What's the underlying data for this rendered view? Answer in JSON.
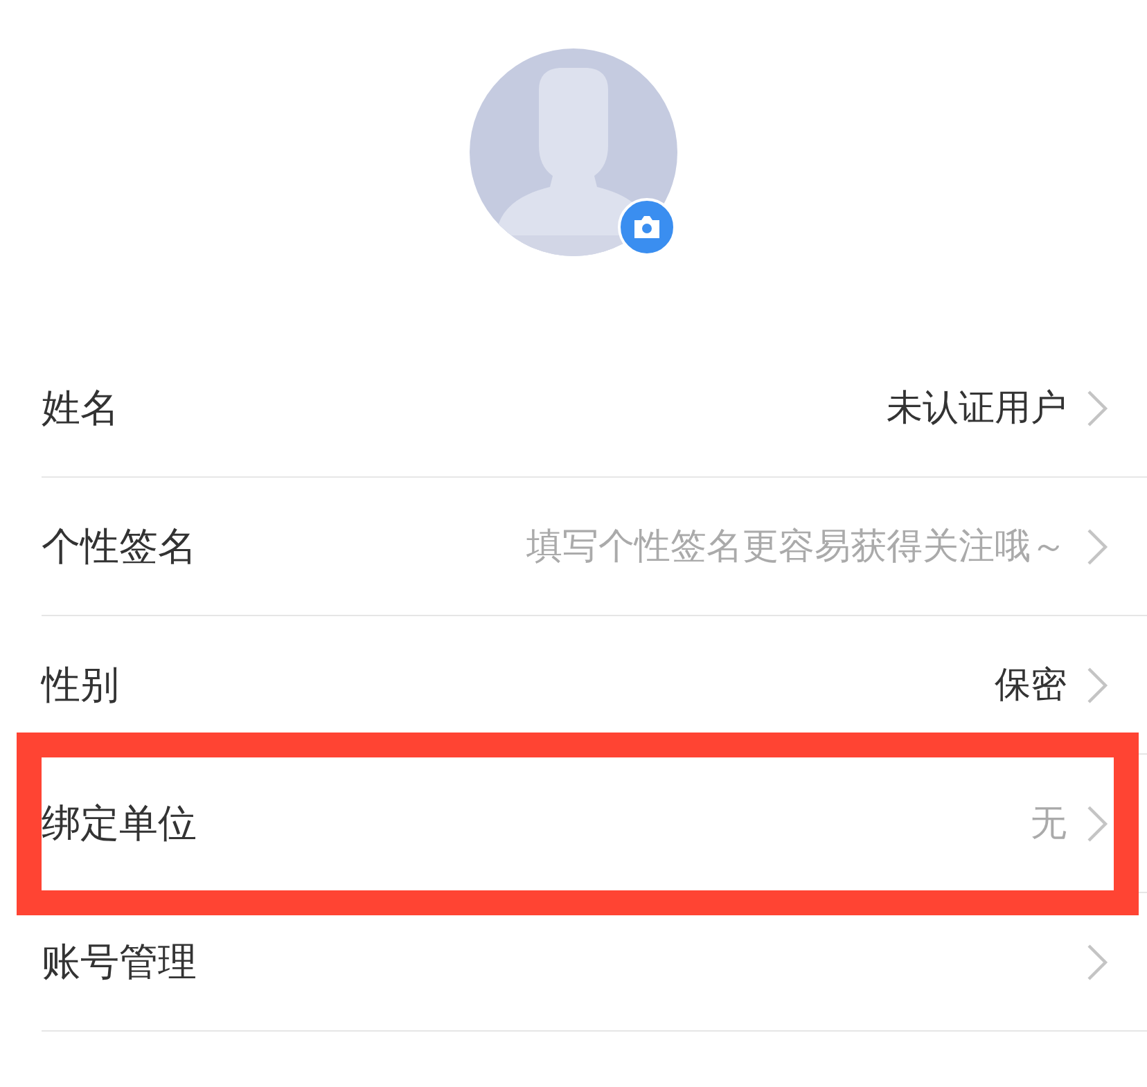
{
  "profile": {
    "avatar": {
      "editable": true
    }
  },
  "rows": [
    {
      "label": "姓名",
      "value": "未认证用户",
      "dimmed": false,
      "highlighted": false
    },
    {
      "label": "个性签名",
      "value": "填写个性签名更容易获得关注哦～",
      "dimmed": true,
      "highlighted": false
    },
    {
      "label": "性别",
      "value": "保密",
      "dimmed": false,
      "highlighted": false
    },
    {
      "label": "绑定单位",
      "value": "无",
      "dimmed": true,
      "highlighted": true
    },
    {
      "label": "账号管理",
      "highlighted": false
    }
  ]
}
